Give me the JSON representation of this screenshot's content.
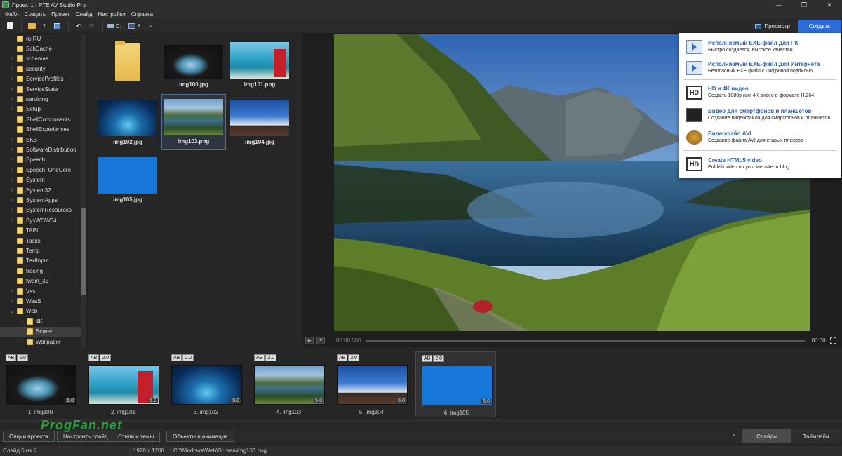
{
  "window": {
    "title": "Проект1 - PTE AV Studio Pro",
    "controls": [
      "—",
      "❐",
      "✕"
    ]
  },
  "menu": [
    "Файл",
    "Создать",
    "Проект",
    "Слайд",
    "Настройки",
    "Справка"
  ],
  "toolbar": {
    "drive_label": "C:",
    "preview_label": "Просмотр",
    "create_label": "Создать"
  },
  "tree": [
    {
      "label": "ru-RU",
      "expand": ""
    },
    {
      "label": "SchCache",
      "expand": ""
    },
    {
      "label": "schemas",
      "expand": ">"
    },
    {
      "label": "security",
      "expand": ">"
    },
    {
      "label": "ServiceProfiles",
      "expand": ">"
    },
    {
      "label": "ServiceState",
      "expand": ">"
    },
    {
      "label": "servicing",
      "expand": ">"
    },
    {
      "label": "Setup",
      "expand": ">"
    },
    {
      "label": "ShellComponents",
      "expand": ""
    },
    {
      "label": "ShellExperiences",
      "expand": ""
    },
    {
      "label": "SKB",
      "expand": ">"
    },
    {
      "label": "SoftwareDistribution",
      "expand": ">"
    },
    {
      "label": "Speech",
      "expand": ">"
    },
    {
      "label": "Speech_OneCore",
      "expand": ">"
    },
    {
      "label": "System",
      "expand": ">"
    },
    {
      "label": "System32",
      "expand": ">"
    },
    {
      "label": "SystemApps",
      "expand": ">"
    },
    {
      "label": "SystemResources",
      "expand": ">"
    },
    {
      "label": "SysWOW64",
      "expand": ">"
    },
    {
      "label": "TAPI",
      "expand": ""
    },
    {
      "label": "Tasks",
      "expand": ""
    },
    {
      "label": "Temp",
      "expand": ""
    },
    {
      "label": "TextInput",
      "expand": ""
    },
    {
      "label": "tracing",
      "expand": ""
    },
    {
      "label": "twain_32",
      "expand": ""
    },
    {
      "label": "Vss",
      "expand": ">"
    },
    {
      "label": "WaaS",
      "expand": ">"
    },
    {
      "label": "Web",
      "expand": "v"
    },
    {
      "label": "4K",
      "expand": ">"
    },
    {
      "label": "Screen",
      "expand": ""
    },
    {
      "label": "Wallpaper",
      "expand": ">"
    }
  ],
  "files": [
    {
      "name": ".."
    },
    {
      "name": "img100.jpg"
    },
    {
      "name": "img101.png"
    },
    {
      "name": "img102.jpg"
    },
    {
      "name": "img103.png"
    },
    {
      "name": "img104.jpg"
    },
    {
      "name": "img105.jpg"
    }
  ],
  "timeline": {
    "start": "00:00.000",
    "end": "00:00"
  },
  "create_menu": [
    {
      "title": "Исполняемый EXE-файл для ПК",
      "subtitle": "Быстро создаётся, высокое качество",
      "icon": "exe-icon"
    },
    {
      "title": "Исполняемый EXE-файл для Интернета",
      "subtitle": "Безопасный EXE файл с цифровой подписью",
      "icon": "exe-icon"
    },
    {
      "title": "HD и 4K видео",
      "subtitle": "Создать 1080p или 4K видео в формате H.264",
      "icon": "hd-icon"
    },
    {
      "title": "Видео для смартфонов и планшетов",
      "subtitle": "Создание видеофайла для смартфонов и планшетов",
      "icon": "tablet-icon"
    },
    {
      "title": "Видеофайл AVI",
      "subtitle": "Создание файла AVI для старых плееров",
      "icon": "avi-icon"
    },
    {
      "title": "Create HTML5 video",
      "subtitle": "Publish video on your website or blog",
      "icon": "hd-icon"
    }
  ],
  "slides": [
    {
      "label": "1. img100",
      "badge_ab": "AB",
      "badge_time": "2.0",
      "duration": "5.0"
    },
    {
      "label": "2. img101",
      "badge_ab": "AB",
      "badge_time": "2.0",
      "duration": "5.0"
    },
    {
      "label": "3. img102",
      "badge_ab": "AB",
      "badge_time": "2.0",
      "duration": "5.0"
    },
    {
      "label": "4. img103",
      "badge_ab": "AB",
      "badge_time": "2.0",
      "duration": "5.0"
    },
    {
      "label": "5. img104",
      "badge_ab": "AB",
      "badge_time": "2.0",
      "duration": "5.0"
    },
    {
      "label": "6. img105",
      "badge_ab": "AB",
      "badge_time": "2.0",
      "duration": "5.0"
    }
  ],
  "bottom": {
    "buttons": [
      "Опции проекта",
      "Настроить слайд",
      "Стили и темы",
      "Объекты и анимация"
    ],
    "watermark": "ProgFan.net",
    "tab_slides": "Слайды",
    "tab_timeline": "Таймлайн"
  },
  "status": {
    "slide": "Слайд 6 из 6",
    "resolution": "1920 x 1200",
    "path": "C:\\Windows\\Web\\Screen\\img103.png"
  },
  "colors": {
    "accent": "#2d6cd8",
    "menu_title": "#2e62b0",
    "panel": "#262626"
  }
}
